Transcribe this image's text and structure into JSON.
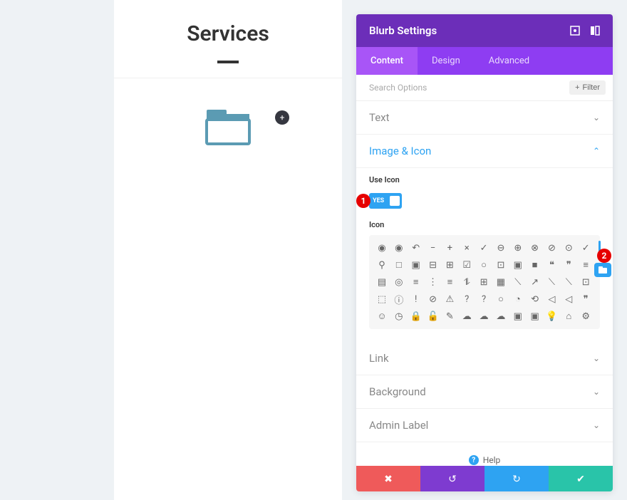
{
  "preview": {
    "title": "Services",
    "icon": "folder-icon",
    "add_label": "+"
  },
  "panel": {
    "title": "Blurb Settings",
    "tabs": [
      {
        "label": "Content",
        "active": true
      },
      {
        "label": "Design",
        "active": false
      },
      {
        "label": "Advanced",
        "active": false
      }
    ],
    "search_placeholder": "Search Options",
    "filter_label": "Filter",
    "sections": {
      "text": {
        "title": "Text",
        "open": false
      },
      "image_icon": {
        "title": "Image & Icon",
        "open": true,
        "use_icon_label": "Use Icon",
        "use_icon_value": "YES",
        "icon_label": "Icon"
      },
      "link": {
        "title": "Link",
        "open": false
      },
      "background": {
        "title": "Background",
        "open": false
      },
      "admin_label": {
        "title": "Admin Label",
        "open": false
      }
    },
    "callouts": {
      "one": "1",
      "two": "2"
    },
    "icon_grid": [
      "◉",
      "◉",
      "↶",
      "−",
      "+",
      "×",
      "✓",
      "⊖",
      "⊕",
      "⊗",
      "⊘",
      "⊙",
      "✓",
      "⚲",
      "□",
      "▣",
      "⊟",
      "⊞",
      "☑",
      "○",
      "⊡",
      "▣",
      "■",
      "❝",
      "❞",
      "≡",
      "▤",
      "◎",
      "≡",
      "⋮",
      "≡",
      "⥮",
      "⊞",
      "▦",
      "⟍",
      "↗",
      "⟍",
      "⟍",
      "⊡",
      "⬚",
      "ⓘ",
      "!",
      "⊘",
      "⚠",
      "?",
      "?",
      "○",
      "◔",
      "⟲",
      "◁",
      "◁",
      "❞",
      "☺",
      "◷",
      "🔒",
      "🔓",
      "✎",
      "☁",
      "☁",
      "☁",
      "▣",
      "▣",
      "💡",
      "⌂",
      "⚙"
    ],
    "help_label": "Help"
  }
}
